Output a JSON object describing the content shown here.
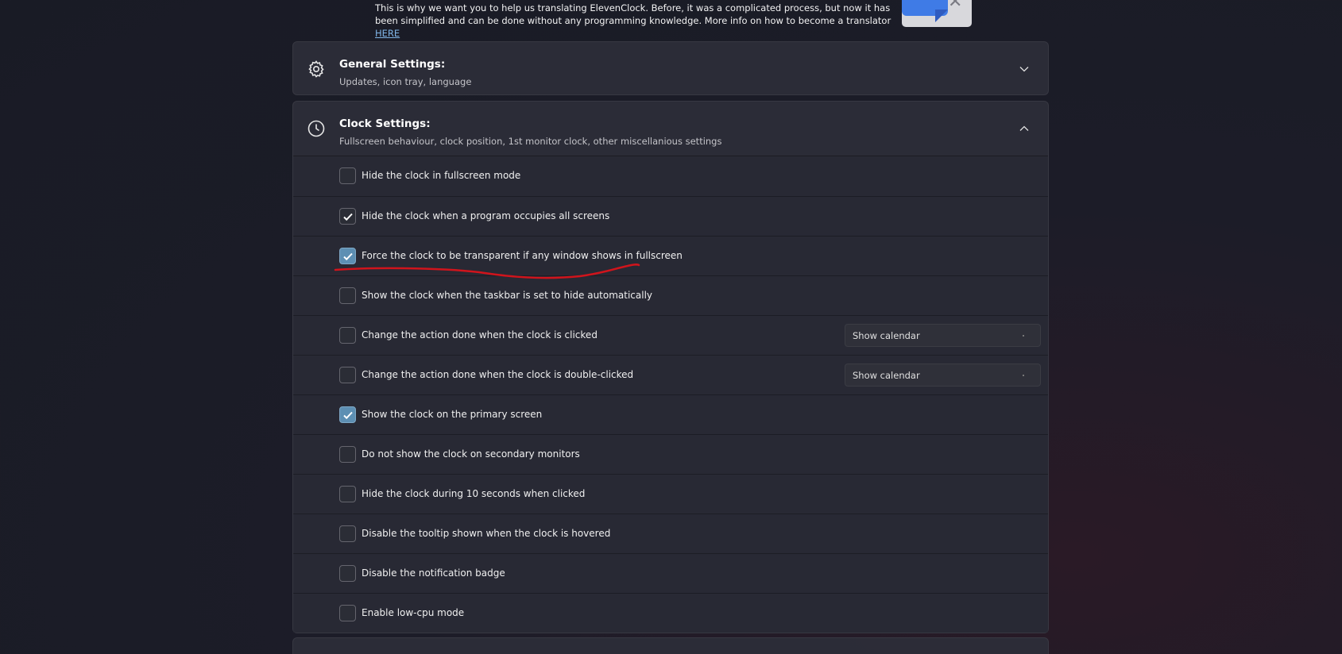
{
  "banner": {
    "text": "This is why we want you to help us translating ElevenClock. Before, it was a complicated process, but now it has been simplified and can be done without any programming knowledge. More info on how to become a translator ",
    "link": "HERE"
  },
  "general": {
    "title": "General Settings:",
    "subtitle": "Updates, icon tray, language",
    "icon": "gear-icon",
    "expanded": false
  },
  "clock": {
    "title": "Clock Settings:",
    "subtitle": "Fullscreen behaviour, clock position, 1st monitor clock, other miscellanious settings",
    "icon": "clock-icon",
    "expanded": true,
    "rows": [
      {
        "label": "Hide the clock in fullscreen mode",
        "checked": false
      },
      {
        "label": "Hide the clock when a program occupies all screens",
        "checked": true
      },
      {
        "label": "Force the clock to be transparent if any window shows in fullscreen",
        "checked": true,
        "highlight": true
      },
      {
        "label": "Show the clock when the taskbar is set to hide automatically",
        "checked": false
      },
      {
        "label": "Change the action done when the clock is clicked",
        "checked": false,
        "select": "Show calendar"
      },
      {
        "label": "Change the action done when the clock is double-clicked",
        "checked": false,
        "select": "Show calendar"
      },
      {
        "label": "Show the clock on the primary screen",
        "checked": true,
        "highlight": true
      },
      {
        "label": "Do not show the clock on secondary monitors",
        "checked": false
      },
      {
        "label": "Hide the clock during 10 seconds when clicked",
        "checked": false
      },
      {
        "label": "Disable the tooltip shown when the clock is hovered",
        "checked": false
      },
      {
        "label": "Disable the notification badge",
        "checked": false
      },
      {
        "label": "Enable low-cpu mode",
        "checked": false
      }
    ]
  },
  "colors": {
    "accent_checkbox": "#5d8fb3",
    "annotation": "#d0141c",
    "link": "#7fb4e6"
  }
}
